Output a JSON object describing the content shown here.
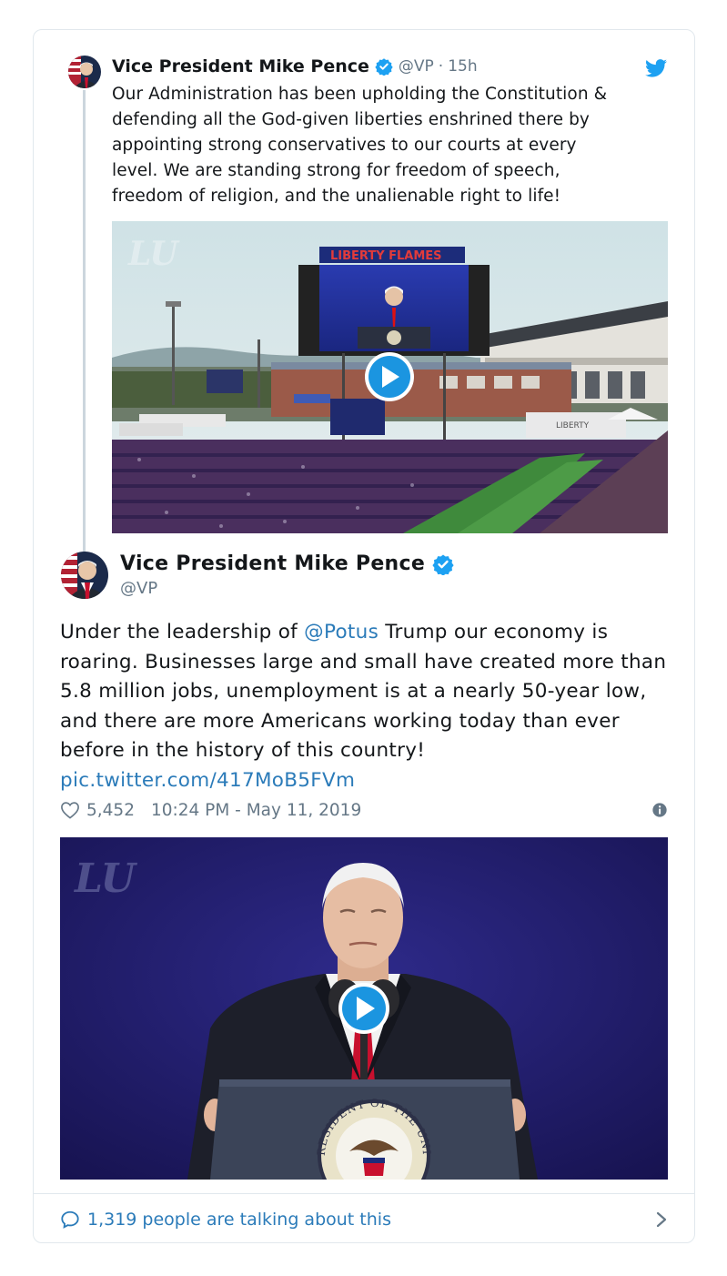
{
  "parent_tweet": {
    "name": "Vice President Mike Pence",
    "handle": "@VP",
    "separator": "·",
    "time": "15h",
    "text": "Our Administration has been upholding the Constitution &\ndefending all the God-given liberties enshrined there by\nappointing strong conservatives to our courts at every\nlevel. We are standing strong for freedom of speech,\nfreedom of religion, and the unalienable right to life!",
    "media": {
      "watermark": "LU",
      "stadium_sign": "LIBERTY FLAMES",
      "truck_sign": "LIBERTY"
    }
  },
  "main_tweet": {
    "name": "Vice President Mike Pence",
    "handle": "@VP",
    "text_before_mention": "Under the leadership of ",
    "mention": "@Potus",
    "text_after_mention": " Trump our economy is roaring. Businesses large and small have created more than 5.8 million jobs, unemployment is at a nearly 50-year low, and there are more Americans working today than ever before in the history of this country!",
    "pic_link": "pic.twitter.com/417MoB5FVm",
    "likes": "5,452",
    "timestamp": "10:24 PM - May 11, 2019",
    "media": {
      "watermark": "LU",
      "seal_text": "RESIDENT OF THE UNITED S"
    }
  },
  "footer": {
    "talking": "1,319 people are talking about this"
  },
  "colors": {
    "link": "#2b7bb9",
    "verified": "#1da1f2",
    "secondary": "#657786",
    "border": "#e1e8ed"
  },
  "icons": {
    "verified": "verified-badge-icon",
    "bird": "twitter-bird-icon",
    "heart": "heart-icon",
    "info": "info-icon",
    "bubble": "speech-bubble-icon",
    "chevron": "chevron-right-icon",
    "play": "play-icon"
  }
}
